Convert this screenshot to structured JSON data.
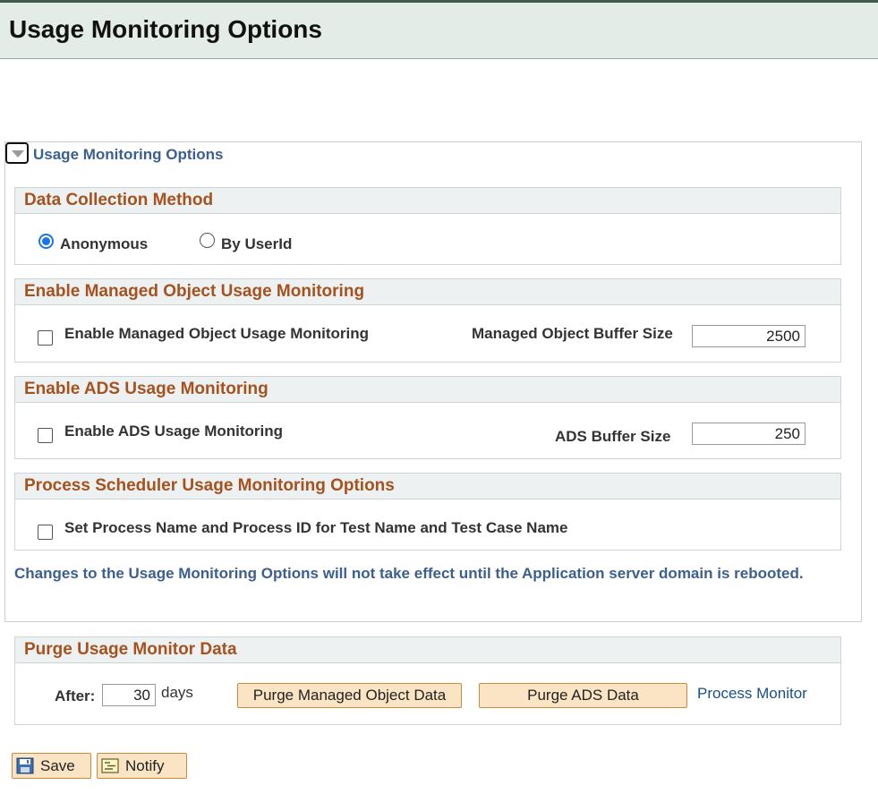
{
  "page": {
    "title": "Usage Monitoring Options"
  },
  "group": {
    "title": "Usage Monitoring Options"
  },
  "data_collection": {
    "header": "Data Collection Method",
    "options": [
      {
        "label": "Anonymous",
        "selected": true
      },
      {
        "label": "By UserId",
        "selected": false
      }
    ]
  },
  "managed_object": {
    "header": "Enable Managed Object Usage Monitoring",
    "checkbox_label": "Enable Managed Object Usage Monitoring",
    "checked": false,
    "buffer_label": "Managed Object Buffer Size",
    "buffer_value": "2500"
  },
  "ads": {
    "header": "Enable ADS Usage Monitoring",
    "checkbox_label": "Enable ADS Usage Monitoring",
    "checked": false,
    "buffer_label": "ADS Buffer Size",
    "buffer_value": "250"
  },
  "process_scheduler": {
    "header": "Process Scheduler Usage Monitoring Options",
    "checkbox_label": "Set Process Name and Process ID for Test Name and Test Case Name",
    "checked": false
  },
  "note": "Changes to the Usage Monitoring Options will not take effect until the Application server domain is rebooted.",
  "purge": {
    "header": "Purge Usage Monitor Data",
    "after_label": "After:",
    "after_value": "30",
    "days_label": "days",
    "purge_managed_button": "Purge Managed Object Data",
    "purge_ads_button": "Purge ADS Data",
    "process_monitor_link": "Process Monitor"
  },
  "toolbar": {
    "save_label": "Save",
    "notify_label": "Notify",
    "save_icon": "floppy-disk-icon",
    "notify_icon": "notify-note-icon"
  },
  "colors": {
    "section_header_text": "#a5521f",
    "link_blue": "#3b5f8f",
    "button_bg": "#fbe4c4",
    "radio_selected": "#1a73e8"
  }
}
